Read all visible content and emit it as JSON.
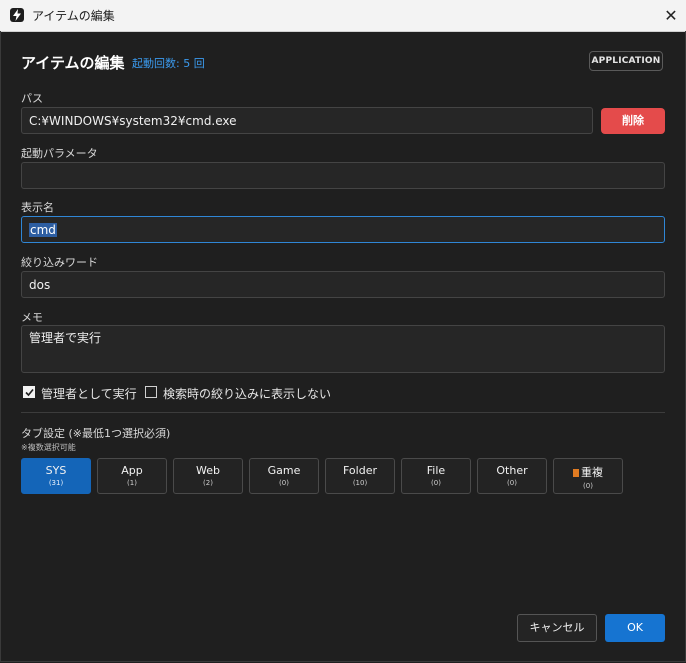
{
  "window": {
    "title": "アイテムの編集",
    "close_glyph": "✕"
  },
  "header": {
    "title": "アイテムの編集",
    "launch_count": "起動回数: 5 回",
    "type_badge": "APPLICATION"
  },
  "form": {
    "path_label": "パス",
    "path_value": "C:¥WINDOWS¥system32¥cmd.exe",
    "delete_label": "削除",
    "params_label": "起動パラメータ",
    "params_value": "",
    "display_name_label": "表示名",
    "display_name_value": "cmd",
    "filter_word_label": "絞り込みワード",
    "filter_word_value": "dos",
    "memo_label": "メモ",
    "memo_value": "管理者で実行"
  },
  "options": {
    "run_as_admin_label": "管理者として実行",
    "run_as_admin_checked": true,
    "hide_in_search_label": "検索時の絞り込みに表示しない",
    "hide_in_search_checked": false
  },
  "tabs": {
    "heading": "タブ設定 (※最低1つ選択必須)",
    "note": "※複数選択可能",
    "items": [
      {
        "name": "SYS",
        "count": "(31)",
        "active": true
      },
      {
        "name": "App",
        "count": "(1)",
        "active": false
      },
      {
        "name": "Web",
        "count": "(2)",
        "active": false
      },
      {
        "name": "Game",
        "count": "(0)",
        "active": false
      },
      {
        "name": "Folder",
        "count": "(10)",
        "active": false
      },
      {
        "name": "File",
        "count": "(0)",
        "active": false
      },
      {
        "name": "Other",
        "count": "(0)",
        "active": false
      },
      {
        "name": "重複",
        "count": "(0)",
        "active": false
      }
    ]
  },
  "footer": {
    "cancel_label": "キャンセル",
    "ok_label": "OK"
  },
  "colors": {
    "accent": "#1674d1",
    "danger": "#e44b4b",
    "background": "#1f1f1f",
    "link": "#3b9bef"
  }
}
